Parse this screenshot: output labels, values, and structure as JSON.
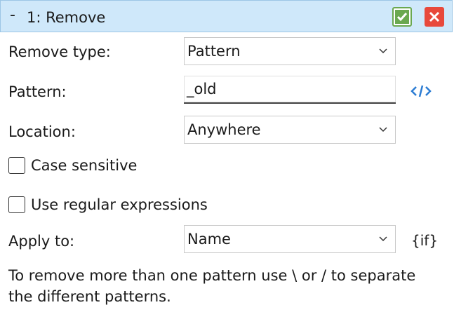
{
  "header": {
    "collapse_symbol": "-",
    "title": "1: Remove",
    "confirm_icon": "checkmark-icon",
    "cancel_icon": "close-icon",
    "colors": {
      "background": "#cfe8fa",
      "confirm": "#6aa84f",
      "cancel": "#e8493b"
    }
  },
  "form": {
    "remove_type": {
      "label": "Remove type:",
      "value": "Pattern"
    },
    "pattern": {
      "label": "Pattern:",
      "value": "_old",
      "side_icon": "code-icon"
    },
    "location": {
      "label": "Location:",
      "value": "Anywhere"
    },
    "case_sensitive": {
      "label": "Case sensitive",
      "checked": false
    },
    "use_regex": {
      "label": "Use regular expressions",
      "checked": false
    },
    "apply_to": {
      "label": "Apply to:",
      "value": "Name",
      "side_label": "{if}"
    }
  },
  "help_text": "To remove more than one pattern use \\ or / to separate the different patterns."
}
